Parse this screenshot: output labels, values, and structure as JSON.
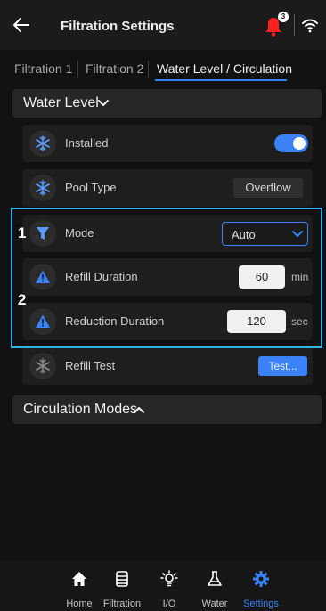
{
  "header": {
    "title": "Filtration Settings",
    "back_icon": "arrow-left-icon",
    "notification_icon": "bell-icon",
    "notification_count": "3",
    "notification_color": "#ff2020",
    "wifi_icon": "wifi-icon"
  },
  "tabs": [
    {
      "label": "Filtration 1",
      "active": false
    },
    {
      "label": "Filtration 2",
      "active": false
    },
    {
      "label": "Water Level / Circulation",
      "active": true
    }
  ],
  "water_level": {
    "title": "Water Level",
    "expanded": true,
    "rows": {
      "installed": {
        "label": "Installed",
        "icon": "snowflake-icon",
        "toggle_on": true
      },
      "pool_type": {
        "label": "Pool Type",
        "icon": "snowflake-icon",
        "value": "Overflow"
      },
      "mode": {
        "label": "Mode",
        "icon": "funnel-icon",
        "value": "Auto"
      },
      "refill_duration": {
        "label": "Refill Duration",
        "icon": "warning-icon",
        "value": "60",
        "unit": "min"
      },
      "reduction_duration": {
        "label": "Reduction Duration",
        "icon": "warning-icon",
        "value": "120",
        "unit": "sec"
      },
      "refill_test": {
        "label": "Refill Test",
        "icon": "snowflake-icon",
        "button": "Test..."
      }
    }
  },
  "circulation": {
    "title": "Circulation Modes",
    "expanded": false
  },
  "annotations": {
    "one": "1",
    "two": "2"
  },
  "bottom_nav": [
    {
      "label": "Home",
      "icon": "home-icon",
      "active": false
    },
    {
      "label": "Filtration",
      "icon": "filtration-icon",
      "active": false
    },
    {
      "label": "I/O",
      "icon": "lightbulb-icon",
      "active": false
    },
    {
      "label": "Water",
      "icon": "flask-icon",
      "active": false
    },
    {
      "label": "Settings",
      "icon": "gear-icon",
      "active": true
    }
  ],
  "colors": {
    "accent": "#3b82f6",
    "annotation_border": "#2bb3e6",
    "background": "#111111",
    "warning_icon": "#3b82f6"
  }
}
